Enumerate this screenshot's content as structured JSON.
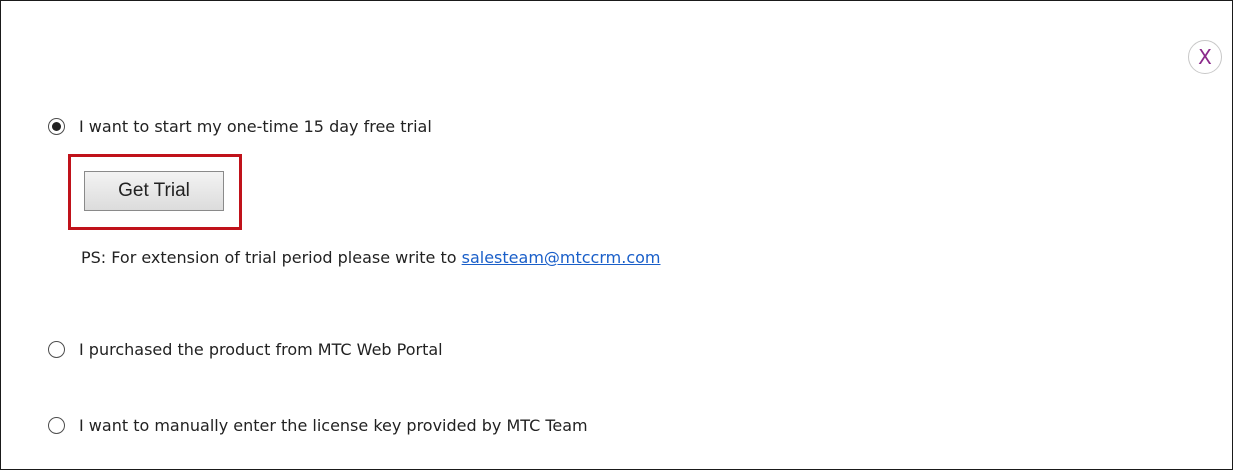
{
  "dialog": {
    "close_label": "X"
  },
  "options": [
    {
      "label": "I want to start my one-time 15 day free trial",
      "selected": true
    },
    {
      "label": "I purchased the product from MTC Web Portal",
      "selected": false
    },
    {
      "label": "I want to manually enter the license key provided by MTC Team",
      "selected": false
    }
  ],
  "trial": {
    "button_label": "Get Trial",
    "ps_text": "PS: For extension of trial period please write to ",
    "email": "salesteam@mtccrm.com"
  },
  "colors": {
    "highlight_border": "#c0121a",
    "close_glyph": "#8b2a8b",
    "link": "#1a5fc9"
  }
}
